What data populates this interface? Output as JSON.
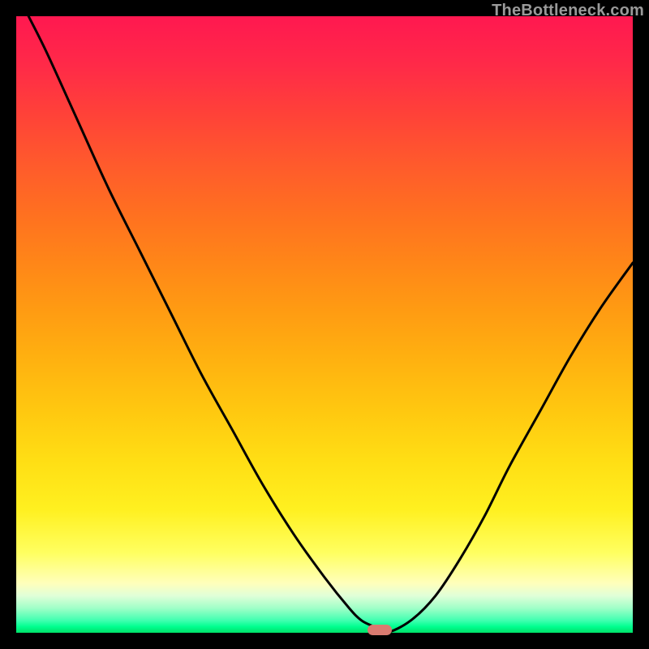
{
  "watermark": "TheBottleneck.com",
  "colors": {
    "background": "#000000",
    "curve": "#000000",
    "marker": "#d97a70"
  },
  "chart_data": {
    "type": "line",
    "title": "",
    "xlabel": "",
    "ylabel": "",
    "xlim": [
      0,
      100
    ],
    "ylim": [
      0,
      100
    ],
    "grid": false,
    "legend": false,
    "series": [
      {
        "name": "bottleneck-curve",
        "x": [
          2,
          5,
          10,
          15,
          20,
          25,
          30,
          35,
          40,
          45,
          50,
          54,
          56,
          58,
          60,
          64,
          68,
          72,
          76,
          80,
          85,
          90,
          95,
          100
        ],
        "y": [
          100,
          94,
          83,
          72,
          62,
          52,
          42,
          33,
          24,
          16,
          9,
          4,
          2,
          1,
          0,
          2,
          6,
          12,
          19,
          27,
          36,
          45,
          53,
          60
        ]
      }
    ],
    "marker": {
      "x": 59,
      "y": 0
    }
  }
}
